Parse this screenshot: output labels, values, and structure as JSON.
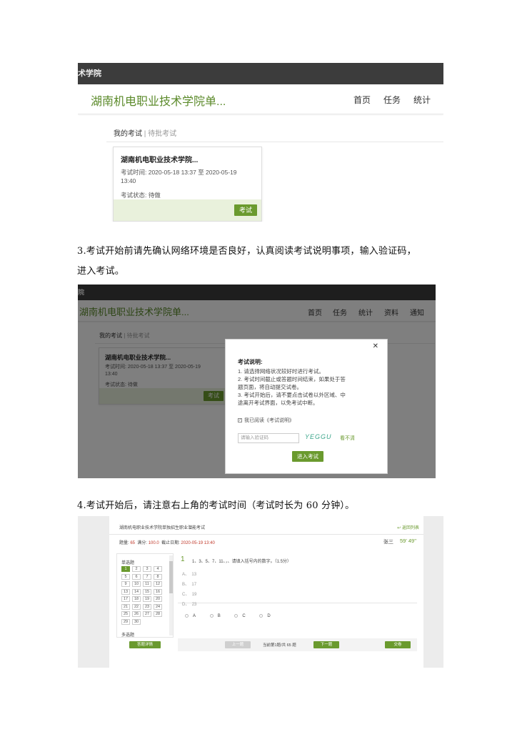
{
  "shot1": {
    "topbar": "术学院",
    "school": "湖南机电职业技术学院单...",
    "nav": [
      "首页",
      "任务",
      "统计"
    ],
    "tab_active": "我的考试",
    "tab_sep": "|",
    "tab_inactive": "待批考试",
    "card": {
      "title": "湖南机电职业技术学院...",
      "time_line1": "考试时间: 2020-05-18 13:37 至 2020-05-19",
      "time_line2": "13:40",
      "status": "考试状态: 待做",
      "button": "考试"
    }
  },
  "para3_line1": "3.考试开始前请先确认网络环境是否良好，认真阅读考试说明事项，输入验证码，",
  "para3_line2": "进入考试。",
  "shot2": {
    "topbar": "院",
    "school": "湖南机电职业技术学院单...",
    "nav": [
      "首页",
      "任务",
      "统计",
      "资料",
      "通知"
    ],
    "tab_active": "我的考试",
    "tab_sep": "|",
    "tab_inactive": "待批考试",
    "card": {
      "title": "湖南机电职业技术学院...",
      "time_line1": "考试时间: 2020-05-18 13:37 至 2020-05-19",
      "time_line2": "13:40",
      "status": "考试状态: 待做",
      "button": "考试"
    },
    "modal": {
      "close": "✕",
      "title": "考试说明:",
      "lines": [
        "1. 请选择网络状况较好时进行考试。",
        "2. 考试时间截止或答题时间结束，如果处于答",
        "题页面，将自动提交试卷。",
        "3. 考试开始后，请不要点击试卷以外区域、中",
        "途离开考试界面，以免考试中断。"
      ],
      "agree": "我已阅读《考试说明》",
      "captcha_placeholder": "请输入验证码",
      "captcha_image_text": "YEGGU",
      "captcha_refresh": "看不清",
      "enter_button": "进入考试"
    }
  },
  "para4": "4.考试开始后，请注意右上角的考试时间（考试时长为 60 分钟）。",
  "shot3": {
    "exam_title": "湖南机电职业技术学院单独招生职业潜能考试",
    "back": "返回列表",
    "info_label_count": "题量:",
    "info_count": "65",
    "info_label_score": "满分:",
    "info_score": "100.0",
    "info_label_deadline": "截止日期:",
    "info_deadline": "2020-05-19 13:40",
    "user": "张三",
    "timer": "59' 49''",
    "section_single": "单选题",
    "numbers": [
      "1",
      "2",
      "3",
      "4",
      "5",
      "6",
      "7",
      "8",
      "9",
      "10",
      "11",
      "12",
      "13",
      "14",
      "15",
      "16",
      "17",
      "18",
      "19",
      "20",
      "21",
      "22",
      "23",
      "24",
      "25",
      "26",
      "27",
      "28",
      "29",
      "30"
    ],
    "section_multi": "多选题",
    "detail_button": "答题详情",
    "q_number": "1",
    "q_text": "1、3、5、7、11、，、请填入括号内的数字。（1.5分）",
    "options": [
      {
        "letter": "A、",
        "value": "13"
      },
      {
        "letter": "B、",
        "value": "17"
      },
      {
        "letter": "C、",
        "value": "19"
      },
      {
        "letter": "D、",
        "value": "23"
      }
    ],
    "choices": [
      "A",
      "B",
      "C",
      "D"
    ],
    "prev": "上一题",
    "progress": "当前第1题/共 65 题",
    "next": "下一题",
    "submit": "交卷"
  }
}
